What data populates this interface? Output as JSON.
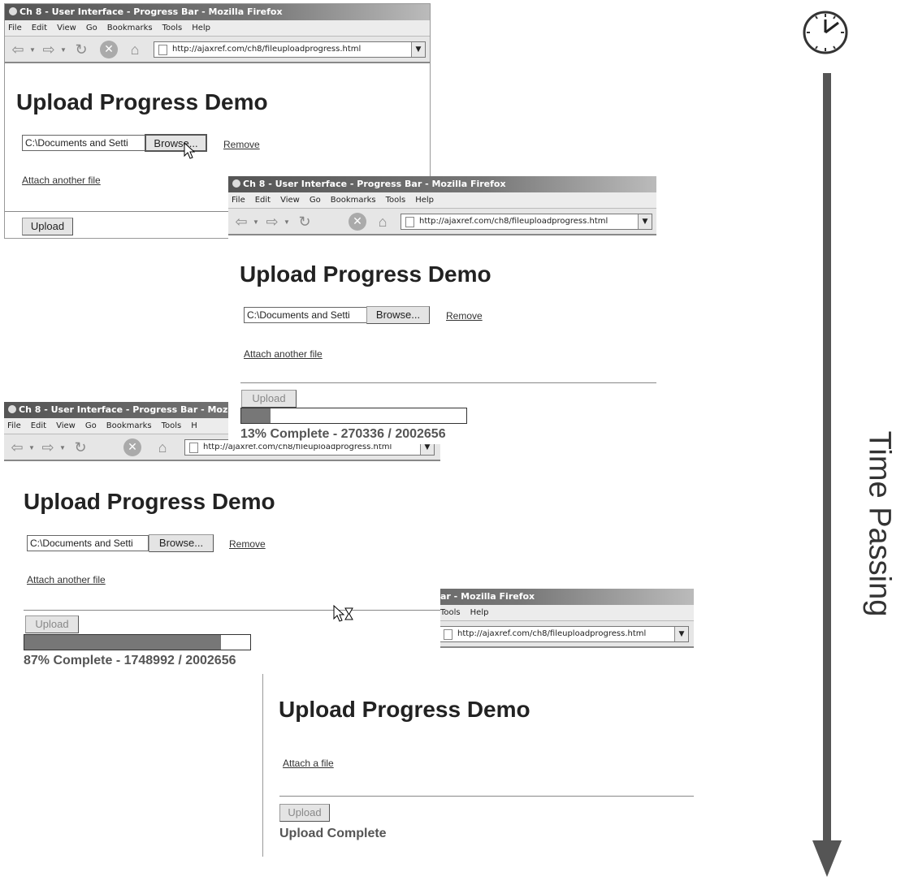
{
  "browser": {
    "title": "Ch 8 - User Interface - Progress Bar - Mozilla Firefox",
    "title_cropped": "Ch 8 - User Interface - Progress Bar - Mozi",
    "title_tail": "ar - Mozilla Firefox",
    "menu": [
      "File",
      "Edit",
      "View",
      "Go",
      "Bookmarks",
      "Tools",
      "Help"
    ],
    "menu_cropped_last": "H",
    "menu_tail": [
      "Tools",
      "Help"
    ],
    "url": "http://ajaxref.com/ch8/fileuploadprogress.html"
  },
  "page": {
    "heading": "Upload Progress Demo",
    "file_value": "C:\\Documents and Setti",
    "browse_label": "Browse...",
    "browse_label_hover": "Browse...",
    "remove_label": "Remove",
    "attach_another": "Attach another file",
    "attach_a_file": "Attach a file",
    "upload_label": "Upload",
    "upload_complete": "Upload Complete"
  },
  "snapshots": [
    {
      "progress": 0.13,
      "status": "13% Complete - 270336 / 2002656"
    },
    {
      "progress": 0.87,
      "status": "87% Complete - 1748992 / 2002656"
    }
  ],
  "timeline": {
    "label": "Time Passing"
  }
}
